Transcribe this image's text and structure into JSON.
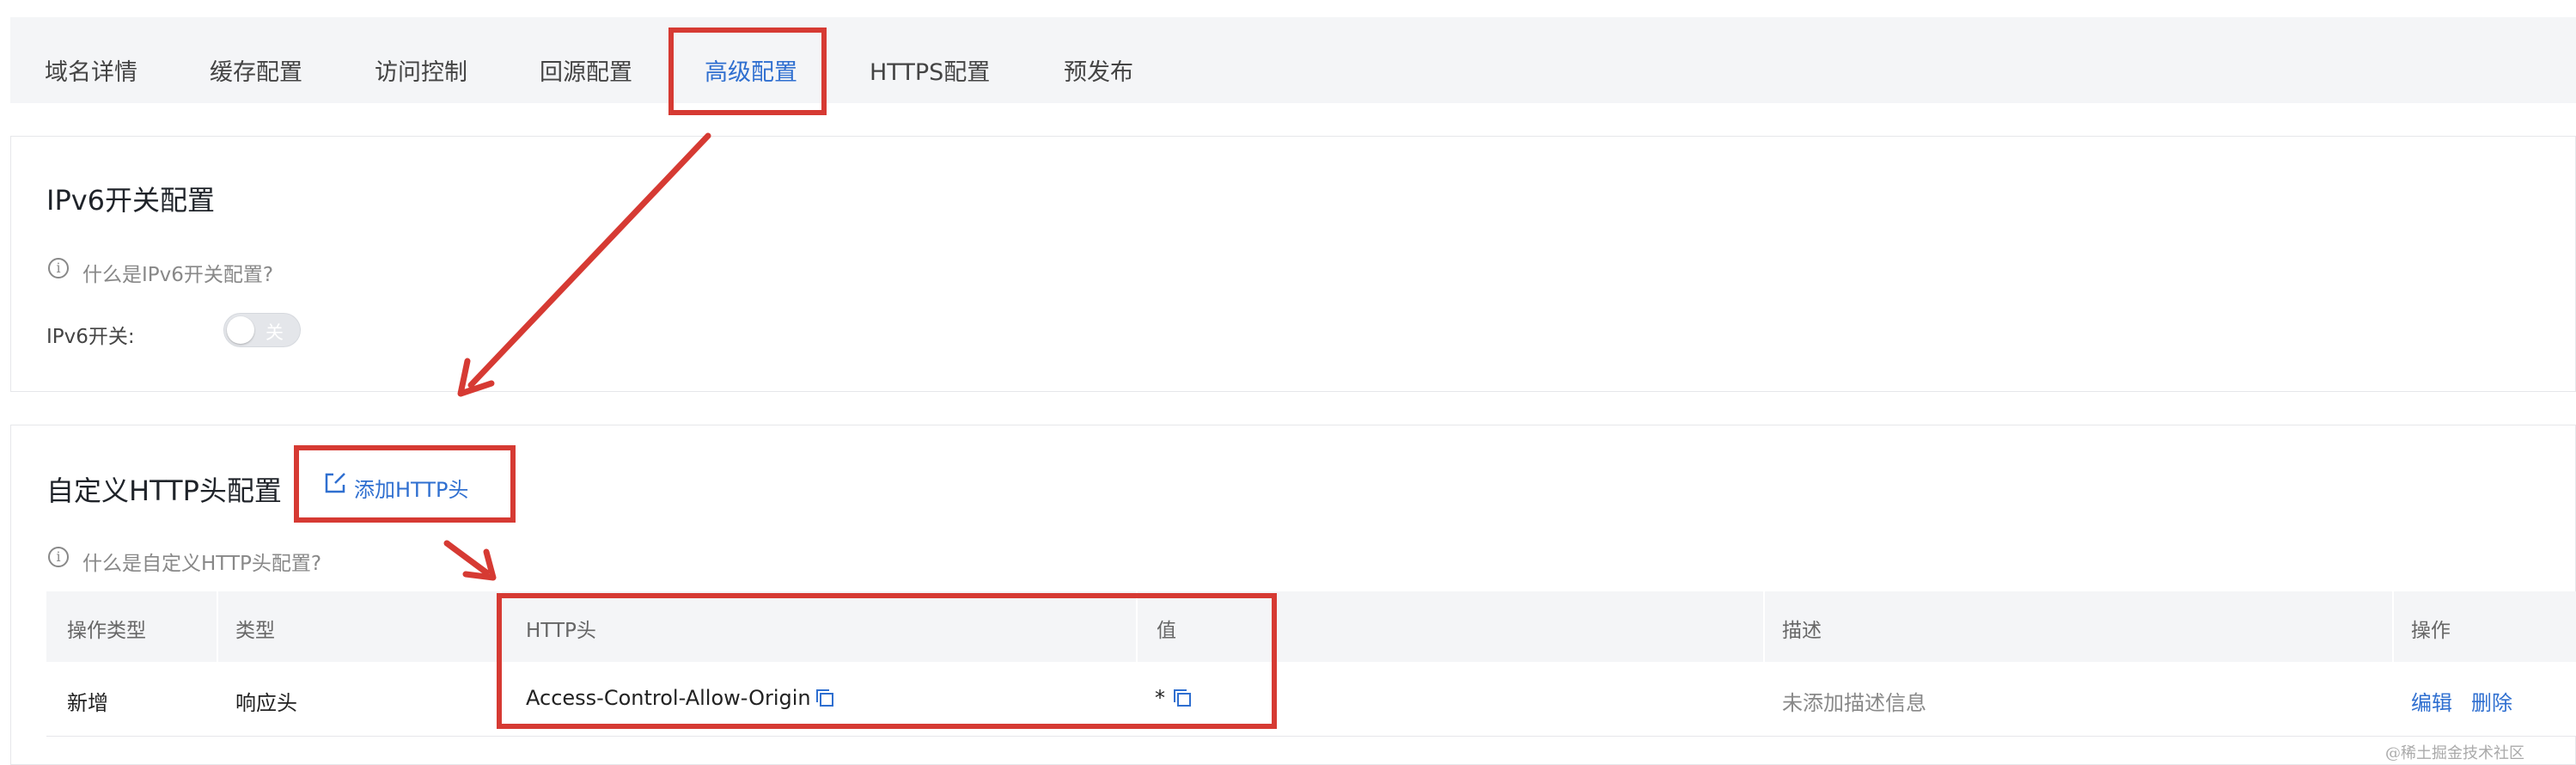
{
  "tabs": [
    {
      "label": "域名详情"
    },
    {
      "label": "缓存配置"
    },
    {
      "label": "访问控制"
    },
    {
      "label": "回源配置"
    },
    {
      "label": "高级配置"
    },
    {
      "label": "HTTPS配置"
    },
    {
      "label": "预发布"
    }
  ],
  "active_tab": "高级配置",
  "ipv6": {
    "title": "IPv6开关配置",
    "hint": "什么是IPv6开关配置?",
    "switch_label": "IPv6开关:",
    "switch_state": "关"
  },
  "http_header": {
    "title": "自定义HTTP头配置",
    "add_label": "添加HTTP头",
    "hint": "什么是自定义HTTP头配置?",
    "columns": [
      "操作类型",
      "类型",
      "HTTP头",
      "值",
      "描述",
      "操作"
    ],
    "rows": [
      {
        "op_type": "新增",
        "type": "响应头",
        "header": "Access-Control-Allow-Origin",
        "value": "*",
        "description": "未添加描述信息",
        "actions": [
          "编辑",
          "删除"
        ]
      }
    ]
  },
  "watermark": "@稀土掘金技术社区",
  "colors": {
    "accent": "#2f6fd0",
    "annotation": "#d63a33"
  },
  "icons": [
    "info-icon",
    "edit-icon",
    "copy-icon",
    "annotation-arrow"
  ]
}
